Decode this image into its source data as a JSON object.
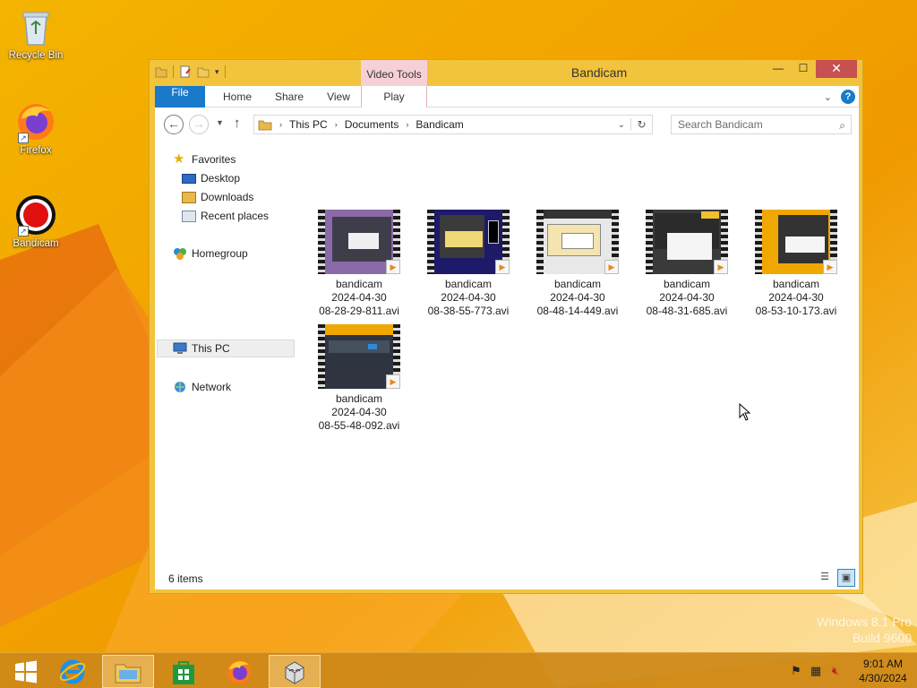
{
  "desktop": {
    "icons": [
      {
        "label": "Recycle Bin",
        "icon": "recycle-bin-icon"
      },
      {
        "label": "Firefox",
        "icon": "firefox-icon"
      },
      {
        "label": "Bandicam",
        "icon": "bandicam-icon"
      }
    ],
    "watermark_line1": "Windows 8.1 Pro",
    "watermark_line2": "Build 9600"
  },
  "window": {
    "title": "Bandicam",
    "contextual_tab": "Video Tools",
    "ribbon_tabs": [
      "File",
      "Home",
      "Share",
      "View",
      "Play"
    ],
    "breadcrumb": [
      "This PC",
      "Documents",
      "Bandicam"
    ],
    "search_placeholder": "Search Bandicam",
    "navpane": {
      "favorites": "Favorites",
      "desktop": "Desktop",
      "downloads": "Downloads",
      "recent_places": "Recent places",
      "homegroup": "Homegroup",
      "this_pc": "This PC",
      "network": "Network"
    },
    "files": [
      {
        "line1": "bandicam",
        "line2": "2024-04-30",
        "line3": "08-28-29-811.avi"
      },
      {
        "line1": "bandicam",
        "line2": "2024-04-30",
        "line3": "08-38-55-773.avi"
      },
      {
        "line1": "bandicam",
        "line2": "2024-04-30",
        "line3": "08-48-14-449.avi"
      },
      {
        "line1": "bandicam",
        "line2": "2024-04-30",
        "line3": "08-48-31-685.avi"
      },
      {
        "line1": "bandicam",
        "line2": "2024-04-30",
        "line3": "08-53-10-173.avi"
      },
      {
        "line1": "bandicam",
        "line2": "2024-04-30",
        "line3": "08-55-48-092.avi"
      }
    ],
    "status_count": "6 items"
  },
  "taskbar": {
    "items": [
      "start-icon",
      "internet-explorer-icon",
      "file-explorer-icon",
      "store-icon",
      "firefox-icon",
      "app-icon"
    ],
    "time": "9:01 AM",
    "date": "4/30/2024"
  },
  "colors": {
    "accent": "#1979ca",
    "close": "#c75050",
    "window_frame": "#f2c33c",
    "desktop": "#f0a800"
  }
}
